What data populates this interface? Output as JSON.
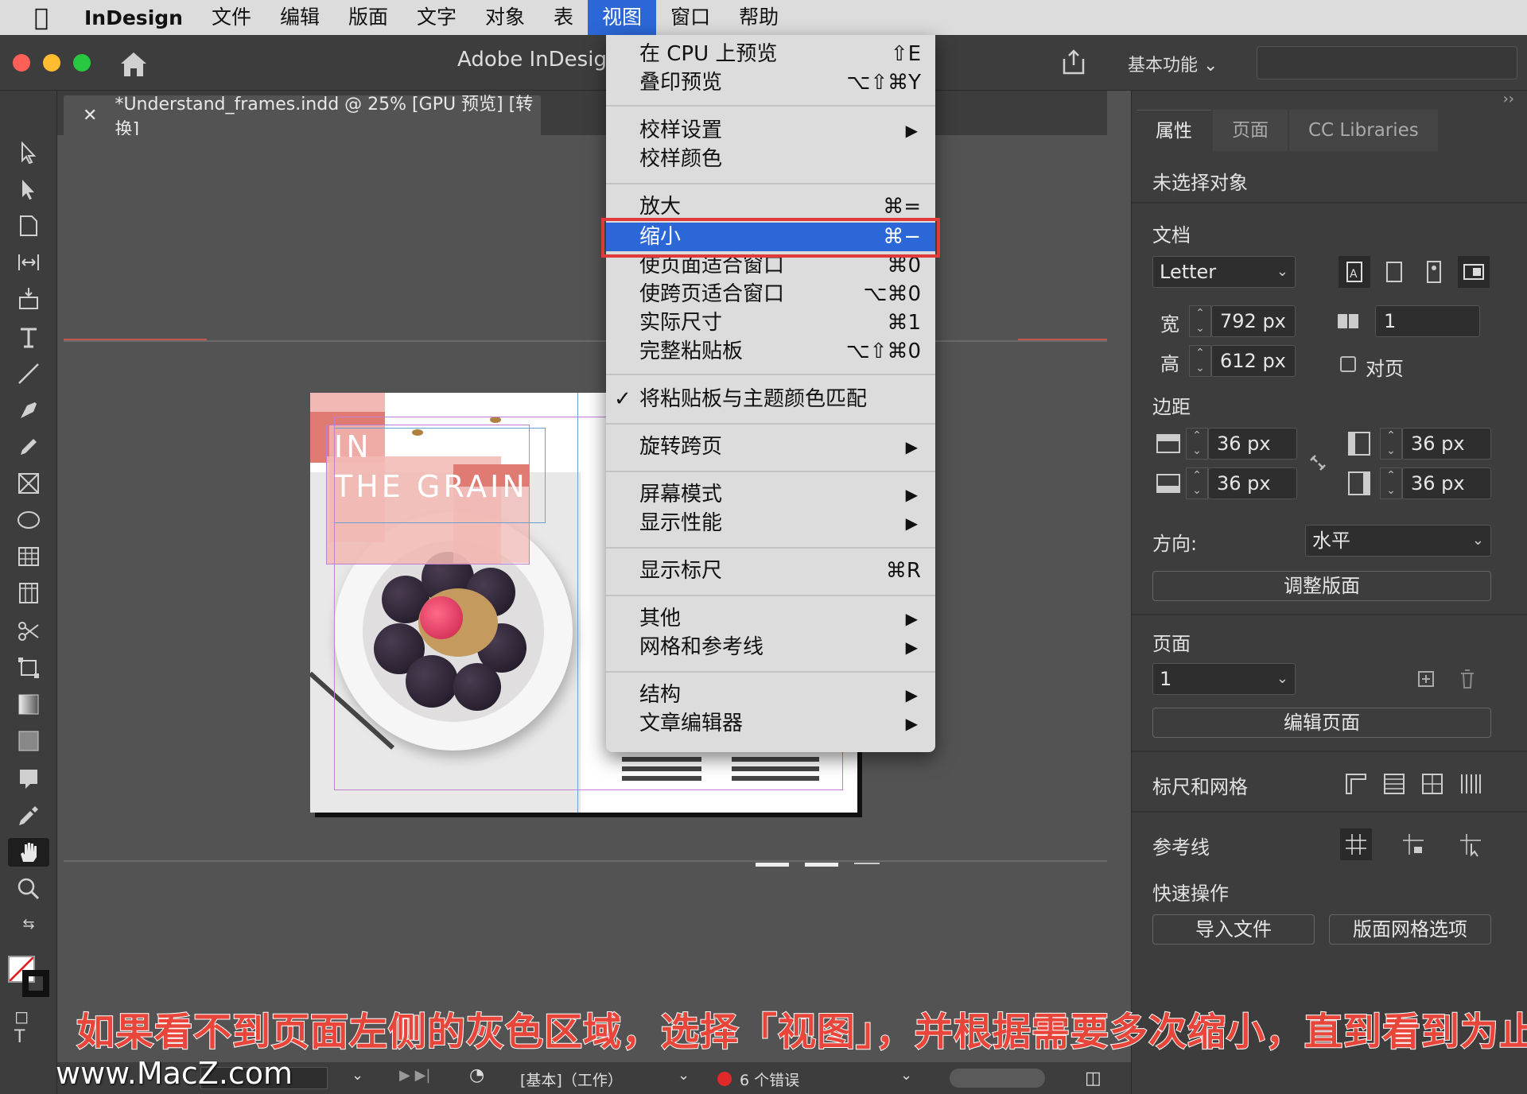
{
  "menubar": {
    "app": "InDesign",
    "items": [
      "文件",
      "编辑",
      "版面",
      "文字",
      "对象",
      "表",
      "视图",
      "窗口",
      "帮助"
    ],
    "active": "视图"
  },
  "titlebar": {
    "title": "Adobe InDesign",
    "workspace": "基本功能"
  },
  "document_tab": {
    "name": "*Understand_frames.indd @ 25% [GPU 预览] [转换]"
  },
  "page_content": {
    "headline_1": "IN",
    "headline_2": "THE GRAIN"
  },
  "view_menu": {
    "groups": [
      [
        {
          "label": "在 CPU 上预览",
          "shortcut": "⇧E"
        },
        {
          "label": "叠印预览",
          "shortcut": "⌥⇧⌘Y"
        }
      ],
      [
        {
          "label": "校样设置",
          "submenu": true
        },
        {
          "label": "校样颜色"
        }
      ],
      [
        {
          "label": "放大",
          "shortcut": "⌘="
        },
        {
          "label": "缩小",
          "shortcut": "⌘−",
          "highlighted": true
        },
        {
          "label": "使页面适合窗口",
          "shortcut": "⌘0"
        },
        {
          "label": "使跨页适合窗口",
          "shortcut": "⌥⌘0"
        },
        {
          "label": "实际尺寸",
          "shortcut": "⌘1"
        },
        {
          "label": "完整粘贴板",
          "shortcut": "⌥⇧⌘0"
        }
      ],
      [
        {
          "label": "将粘贴板与主题颜色匹配",
          "checked": true
        }
      ],
      [
        {
          "label": "旋转跨页",
          "submenu": true
        }
      ],
      [
        {
          "label": "屏幕模式",
          "submenu": true
        },
        {
          "label": "显示性能",
          "submenu": true
        }
      ],
      [
        {
          "label": "显示标尺",
          "shortcut": "⌘R"
        }
      ],
      [
        {
          "label": "其他",
          "submenu": true
        },
        {
          "label": "网格和参考线",
          "submenu": true
        }
      ],
      [
        {
          "label": "结构",
          "submenu": true
        },
        {
          "label": "文章编辑器",
          "submenu": true
        }
      ]
    ]
  },
  "properties_panel": {
    "tabs": [
      "属性",
      "页面",
      "CC Libraries"
    ],
    "active_tab": "属性",
    "selection": "未选择对象",
    "document_label": "文档",
    "page_size": "Letter",
    "width_label": "宽",
    "width": "792 px",
    "height_label": "高",
    "height": "612 px",
    "pages_count": "1",
    "facing_pages_label": "对页",
    "margins_label": "边距",
    "margin_top": "36 px",
    "margin_bottom": "36 px",
    "margin_left": "36 px",
    "margin_right": "36 px",
    "orientation_label": "方向:",
    "orientation": "水平",
    "adjust_layout": "调整版面",
    "page_label": "页面",
    "current_page": "1",
    "edit_page": "编辑页面",
    "rulers_grids": "标尺和网格",
    "guides": "参考线",
    "quick_actions": "快速操作",
    "import_file": "导入文件",
    "layout_grid_options": "版面网格选项"
  },
  "statusbar": {
    "style": "[基本]（工作）",
    "errors": "6 个错误"
  },
  "caption": "如果看不到页面左侧的灰色区域，选择「视图」，并根据需要多次缩小，直到看到为止",
  "watermark": "www.MacZ.com",
  "colors": {
    "menu_highlight": "#2b67d6",
    "callout_red": "#e03a3a",
    "caption_red": "#e8463a",
    "brand_pink": "#e07b74"
  }
}
